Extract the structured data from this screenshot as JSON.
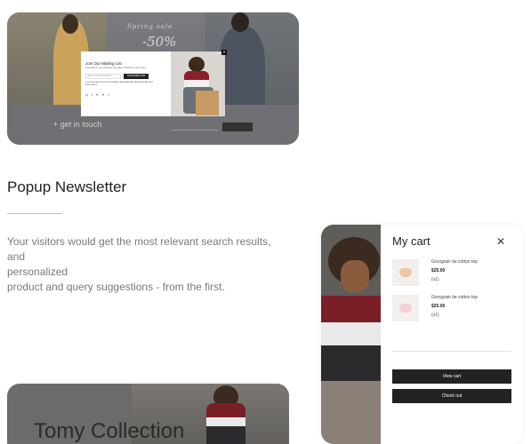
{
  "preview": {
    "sale_title": "Spring sale",
    "sale_percent": "-50%",
    "touch_label": "get in touch",
    "popup": {
      "title": "Join Our Mailing List",
      "subtitle": "Promotions, new products and sales. Directly to your inbox.",
      "input_placeholder": "Enter your email address",
      "button": "SUBSCRIBE NOW",
      "note": "SIGN UP FOR EXCLUSIVE UPDATES, NEW ARRIVALS AND INSIDER ONLY DISCOUNTS",
      "close": "✕",
      "socials": [
        "instagram-icon",
        "facebook-icon",
        "pinterest-icon",
        "twitter-icon",
        "tumblr-icon"
      ]
    }
  },
  "section": {
    "title": "Popup Newsletter",
    "description_line1": "Your visitors would get the most relevant search results, and",
    "description_line2": "personalized",
    "description_line3": "product and query suggestions - from the first."
  },
  "cart": {
    "title": "My cart",
    "close": "✕",
    "items": [
      {
        "name": "Grosgrain tie cotton top",
        "price": "$25.00",
        "qty": "(x1)",
        "thumb_color": "#e9c9a8"
      },
      {
        "name": "Grosgrain tie cotton top",
        "price": "$25.00",
        "qty": "(x1)",
        "thumb_color": "#f4cfd3"
      }
    ],
    "view_cart": "View cart",
    "checkout": "Check out"
  },
  "collection": {
    "title": "Tomy Collection"
  },
  "colors": {
    "accent_pink": "#f0a3c8",
    "button_dark": "#222222"
  }
}
